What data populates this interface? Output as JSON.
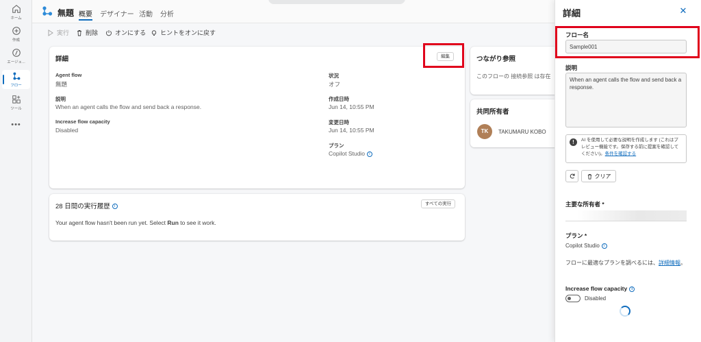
{
  "rail": {
    "items": [
      {
        "label": "ホーム",
        "icon": "home-icon"
      },
      {
        "label": "作成",
        "icon": "plus-circle-icon"
      },
      {
        "label": "エージェ...",
        "icon": "agent-icon"
      },
      {
        "label": "フロー",
        "icon": "flow-icon",
        "active": true
      },
      {
        "label": "ツール",
        "icon": "tools-icon"
      }
    ],
    "more": "•••"
  },
  "header": {
    "flow_name": "無題",
    "tabs": [
      {
        "label": "概要",
        "active": true
      },
      {
        "label": "デザイナー"
      },
      {
        "label": "活動"
      },
      {
        "label": "分析"
      }
    ]
  },
  "commands": {
    "run": "実行",
    "delete": "削除",
    "turn_on": "オンにする",
    "hint": "ヒントをオンに戻す"
  },
  "details_card": {
    "title": "詳細",
    "edit_label": "編集",
    "fields_left": [
      {
        "label": "Agent flow",
        "value": "無題"
      },
      {
        "label": "説明",
        "value": "When an agent calls the flow and send back a response."
      },
      {
        "label": "Increase flow capacity",
        "value": "Disabled"
      }
    ],
    "fields_right": [
      {
        "label": "状況",
        "value": "オフ"
      },
      {
        "label": "作成日時",
        "value": "Jun 14, 10:55 PM"
      },
      {
        "label": "変更日時",
        "value": "Jun 14, 10:55 PM"
      },
      {
        "label": "プラン",
        "value": "Copilot Studio"
      }
    ]
  },
  "connections_card": {
    "title": "つながり参照",
    "text": "このフローの 接続参照 は存在"
  },
  "coowners_card": {
    "title": "共同所有者",
    "avatar_initials": "TK",
    "owner_name": "TAKUMARU KOBO"
  },
  "history_card": {
    "title": "28 日間の実行履歴",
    "all_runs_label": "すべての実行",
    "message_before": "Your agent flow hasn't been run yet. Select ",
    "message_bold": "Run",
    "message_after": " to see it work."
  },
  "panel": {
    "title": "詳細",
    "close_glyph": "✕",
    "flow_name_label": "フロー名",
    "flow_name_value": "Sample001",
    "description_label": "説明",
    "description_value": "When an agent calls the flow and send back a response.",
    "notice_text": "AI を使用して必要な説明を作成します (これはプレビュー機能です。保存する前に提案を確認してください)。",
    "notice_link": "条件を確認する",
    "clear_label": "クリア",
    "primary_owner_label": "主要な所有者 *",
    "plan_label": "プラン *",
    "plan_value": "Copilot Studio",
    "plan_hint": "フローに最適なプランを調べるには、",
    "plan_hint_link": "詳細情報",
    "plan_hint_end": "。",
    "capacity_label": "Increase flow capacity",
    "capacity_value": "Disabled"
  },
  "colors": {
    "accent": "#0f6cbd",
    "highlight": "#e0001b",
    "avatar": "#b07f57"
  }
}
